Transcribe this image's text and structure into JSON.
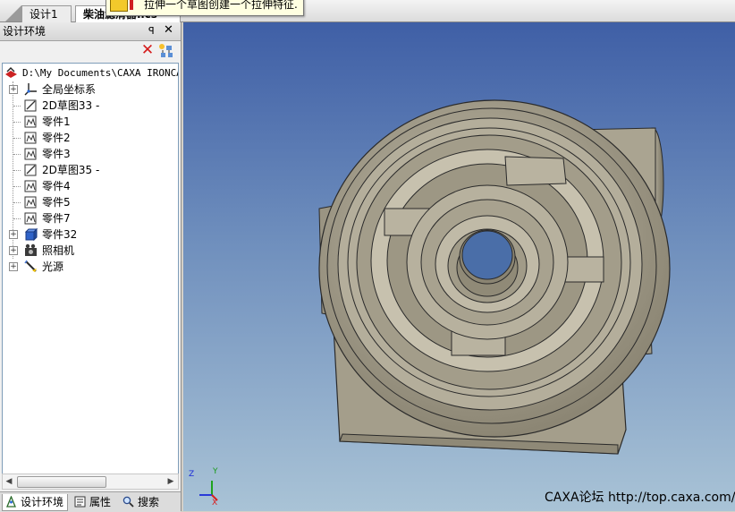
{
  "tabs": [
    {
      "label": "设计1"
    },
    {
      "label": "柴油滤清器.ics"
    }
  ],
  "tooltip": {
    "text": "拉伸一个草图创建一个拉伸特征."
  },
  "panel": {
    "title": "设计环境",
    "pin": "ᵖ",
    "close": "✕"
  },
  "tree": {
    "root": "D:\\My Documents\\CAXA IRONCAD",
    "items": [
      {
        "label": "全局坐标系",
        "icon": "axes-icon",
        "expandable": true
      },
      {
        "label": "2D草图33 -",
        "icon": "sketch-icon",
        "expandable": false
      },
      {
        "label": "零件1",
        "icon": "part-icon",
        "expandable": false
      },
      {
        "label": "零件2",
        "icon": "part-icon",
        "expandable": false
      },
      {
        "label": "零件3",
        "icon": "part-icon",
        "expandable": false
      },
      {
        "label": "2D草图35 -",
        "icon": "sketch-icon",
        "expandable": false
      },
      {
        "label": "零件4",
        "icon": "part-icon",
        "expandable": false
      },
      {
        "label": "零件5",
        "icon": "part-icon",
        "expandable": false
      },
      {
        "label": "零件7",
        "icon": "part-icon",
        "expandable": false
      },
      {
        "label": "零件32",
        "icon": "assembly-icon",
        "expandable": true
      },
      {
        "label": "照相机",
        "icon": "camera-icon",
        "expandable": true
      },
      {
        "label": "光源",
        "icon": "light-icon",
        "expandable": true
      }
    ]
  },
  "bottom_tabs": [
    {
      "label": "设计环境",
      "icon": "design-env-icon",
      "active": true
    },
    {
      "label": "属性",
      "icon": "properties-icon",
      "active": false
    },
    {
      "label": "搜索",
      "icon": "search-icon",
      "active": false
    }
  ],
  "viewport": {
    "axis_labels": {
      "x": "X",
      "y": "Y",
      "z": "Z"
    },
    "watermark": "CAXA论坛 http://top.caxa.com/"
  },
  "colors": {
    "viewport_top": "#3f5fa6",
    "viewport_bottom": "#a9c3d6",
    "model_body": "#a8a290"
  }
}
